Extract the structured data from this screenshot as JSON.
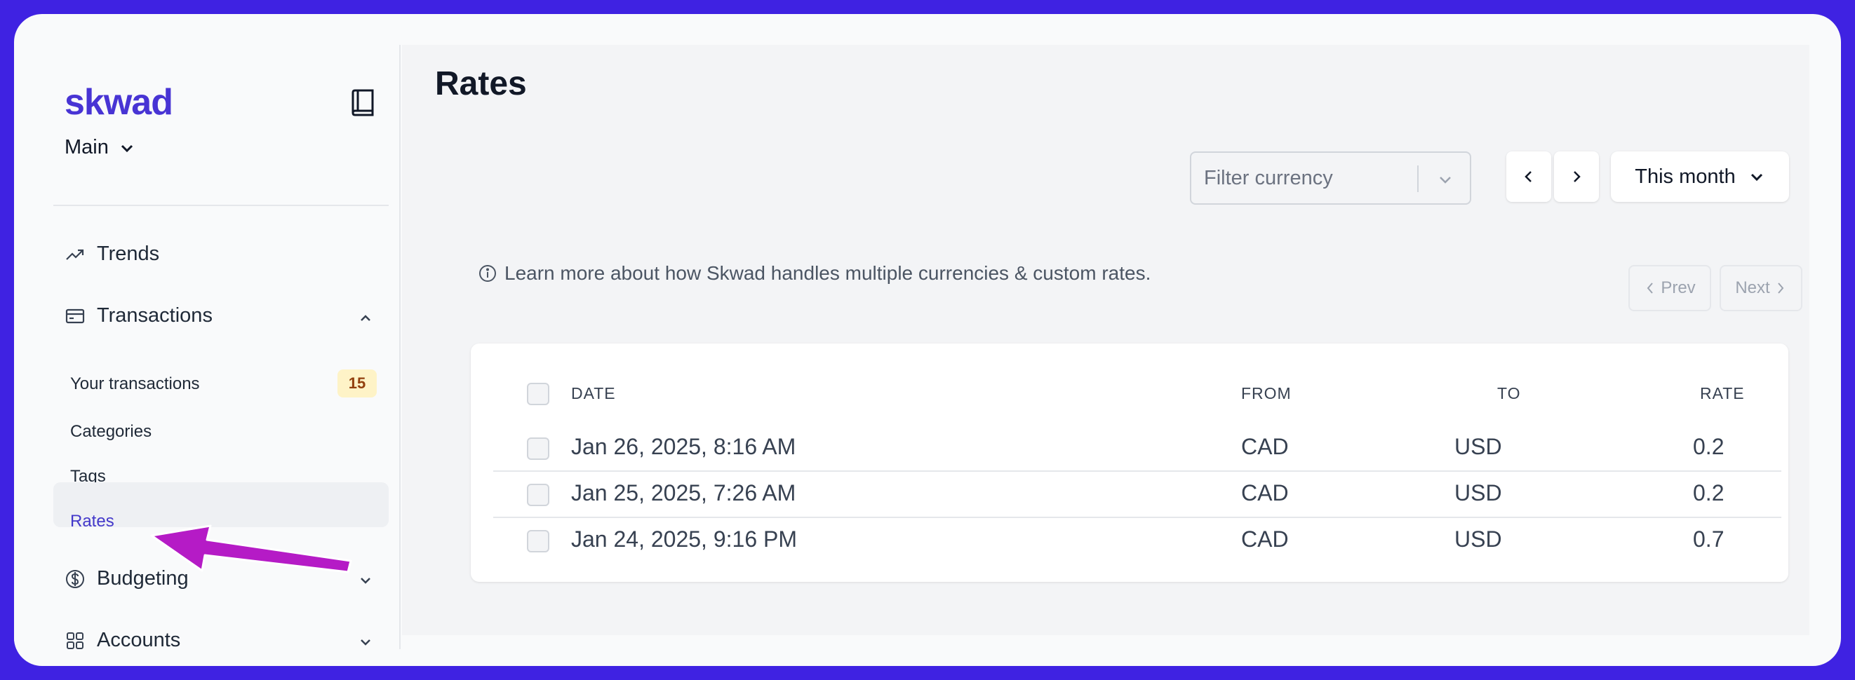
{
  "app": {
    "logo": "skwad",
    "workspace": "Main"
  },
  "sidebar": {
    "trends": "Trends",
    "transactions": "Transactions",
    "sub_items": [
      {
        "label": "Your transactions",
        "badge": "15"
      },
      {
        "label": "Categories"
      },
      {
        "label": "Tags"
      },
      {
        "label": "Rates"
      }
    ],
    "budgeting": "Budgeting",
    "accounts": "Accounts"
  },
  "main": {
    "title": "Rates",
    "filter_placeholder": "Filter currency",
    "month_label": "This month",
    "info_text": "Learn more about how Skwad handles multiple currencies & custom rates.",
    "prev_label": "Prev",
    "next_label": "Next"
  },
  "table": {
    "headers": {
      "date": "DATE",
      "from": "FROM",
      "to": "TO",
      "rate": "RATE"
    },
    "rows": [
      {
        "date": "Jan 26, 2025, 8:16 AM",
        "from": "CAD",
        "to": "USD",
        "rate": "0.2"
      },
      {
        "date": "Jan 25, 2025, 7:26 AM",
        "from": "CAD",
        "to": "USD",
        "rate": "0.2"
      },
      {
        "date": "Jan 24, 2025, 9:16 PM",
        "from": "CAD",
        "to": "USD",
        "rate": "0.7"
      }
    ]
  },
  "colors": {
    "background": "#3f22e2",
    "brand": "#4834d4",
    "active_nav": "#4338ca",
    "annotation_arrow": "#b51bc6"
  }
}
